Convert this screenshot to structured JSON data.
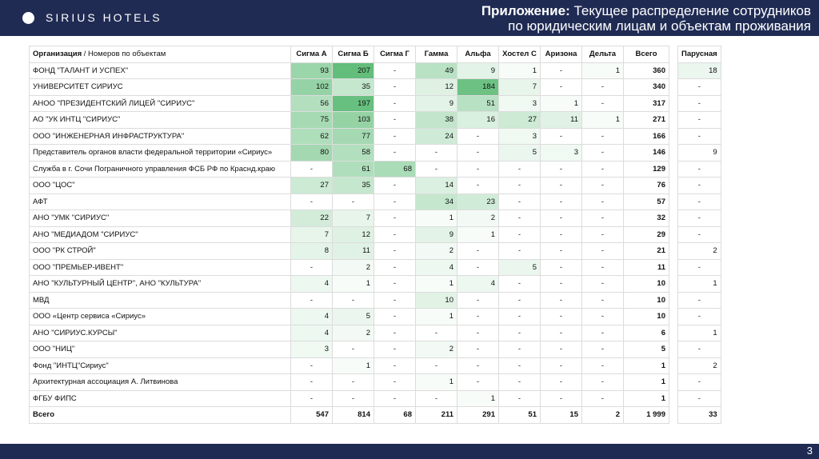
{
  "brand": {
    "name": "SIRIUS HOTELS",
    "logo": "sirius-dot-logo"
  },
  "title": {
    "bold": "Приложение:",
    "line1": "Текущее распределение сотрудников",
    "line2": "по юридическим лицам и объектам проживания"
  },
  "page_number": "3",
  "table": {
    "org_header_bold": "Организация",
    "org_header_rest": " / Номеров по объектам",
    "columns": [
      "Сигма А",
      "Сигма Б",
      "Сигма Г",
      "Гамма",
      "Альфа",
      "Хостел С",
      "Аризона",
      "Дельта",
      "Всего"
    ],
    "rows": [
      {
        "org": "ФОНД \"ТАЛАНТ И УСПЕХ\"",
        "cells": [
          "93",
          "207",
          "-",
          "49",
          "9",
          "1",
          "-",
          "1",
          "360"
        ]
      },
      {
        "org": "УНИВЕРСИТЕТ СИРИУС",
        "cells": [
          "102",
          "35",
          "-",
          "12",
          "184",
          "7",
          "-",
          "-",
          "340"
        ]
      },
      {
        "org": "АНОО \"ПРЕЗИДЕНТСКИЙ ЛИЦЕЙ \"СИРИУС\"",
        "cells": [
          "56",
          "197",
          "-",
          "9",
          "51",
          "3",
          "1",
          "-",
          "317"
        ]
      },
      {
        "org": "АО \"УК ИНТЦ \"СИРИУС\"",
        "cells": [
          "75",
          "103",
          "-",
          "38",
          "16",
          "27",
          "11",
          "1",
          "271"
        ]
      },
      {
        "org": "ООО \"ИНЖЕНЕРНАЯ ИНФРАСТРУКТУРА\"",
        "cells": [
          "62",
          "77",
          "-",
          "24",
          "-",
          "3",
          "-",
          "-",
          "166"
        ]
      },
      {
        "org": "Представитель органов власти федеральной территории «Сириус»",
        "cells": [
          "80",
          "58",
          "-",
          "-",
          "-",
          "5",
          "3",
          "-",
          "146"
        ]
      },
      {
        "org": "Служба в г. Сочи Пограничного управления ФСБ РФ по Краснд.краю",
        "cells": [
          "-",
          "61",
          "68",
          "-",
          "-",
          "-",
          "-",
          "-",
          "129"
        ]
      },
      {
        "org": "ООО \"ЦОС\"",
        "cells": [
          "27",
          "35",
          "-",
          "14",
          "-",
          "-",
          "-",
          "-",
          "76"
        ]
      },
      {
        "org": "АФТ",
        "cells": [
          "-",
          "-",
          "-",
          "34",
          "23",
          "-",
          "-",
          "-",
          "57"
        ]
      },
      {
        "org": "АНО \"УМК \"СИРИУС\"",
        "cells": [
          "22",
          "7",
          "-",
          "1",
          "2",
          "-",
          "-",
          "-",
          "32"
        ]
      },
      {
        "org": "АНО \"МЕДИАДОМ \"СИРИУС\"",
        "cells": [
          "7",
          "12",
          "-",
          "9",
          "1",
          "-",
          "-",
          "-",
          "29"
        ]
      },
      {
        "org": "ООО \"РК СТРОЙ\"",
        "cells": [
          "8",
          "11",
          "-",
          "2",
          "-",
          "-",
          "-",
          "-",
          "21"
        ]
      },
      {
        "org": "ООО \"ПРЕМЬЕР-ИВЕНТ\"",
        "cells": [
          "-",
          "2",
          "-",
          "4",
          "-",
          "5",
          "-",
          "-",
          "11"
        ]
      },
      {
        "org": "АНО \"КУЛЬТУРНЫЙ ЦЕНТР\", АНО \"КУЛЬТУРА\"",
        "cells": [
          "4",
          "1",
          "-",
          "1",
          "4",
          "-",
          "-",
          "-",
          "10"
        ]
      },
      {
        "org": "МВД",
        "cells": [
          "-",
          "-",
          "-",
          "10",
          "-",
          "-",
          "-",
          "-",
          "10"
        ]
      },
      {
        "org": "ООО «Центр сервиса «Сириус»",
        "cells": [
          "4",
          "5",
          "-",
          "1",
          "-",
          "-",
          "-",
          "-",
          "10"
        ]
      },
      {
        "org": "АНО \"СИРИУС.КУРСЫ\"",
        "cells": [
          "4",
          "2",
          "-",
          "-",
          "-",
          "-",
          "-",
          "-",
          "6"
        ]
      },
      {
        "org": "ООО \"НИЦ\"",
        "cells": [
          "3",
          "-",
          "-",
          "2",
          "-",
          "-",
          "-",
          "-",
          "5"
        ]
      },
      {
        "org": "Фонд \"ИНТЦ\"Сириус\"",
        "cells": [
          "-",
          "1",
          "-",
          "-",
          "-",
          "-",
          "-",
          "-",
          "1"
        ]
      },
      {
        "org": "Архитектурная ассоциация А. Литвинова",
        "cells": [
          "-",
          "-",
          "-",
          "1",
          "-",
          "-",
          "-",
          "-",
          "1"
        ]
      },
      {
        "org": "ФГБУ ФИПС",
        "cells": [
          "-",
          "-",
          "-",
          "-",
          "1",
          "-",
          "-",
          "-",
          "1"
        ]
      }
    ],
    "totals": {
      "label": "Всего",
      "cells": [
        "547",
        "814",
        "68",
        "211",
        "291",
        "51",
        "15",
        "2",
        "1 999"
      ]
    }
  },
  "side_table": {
    "header": "Парусная",
    "rows": [
      "18",
      "-",
      "-",
      "-",
      "-",
      "9",
      "-",
      "-",
      "-",
      "-",
      "-",
      "2",
      "-",
      "1",
      "-",
      "-",
      "1",
      "-",
      "2",
      "-",
      "-"
    ],
    "total": "33"
  },
  "colors": {
    "header_bg": "#1f2b53",
    "heat_max": "#63be7b",
    "heat_min": "#ffffff"
  }
}
